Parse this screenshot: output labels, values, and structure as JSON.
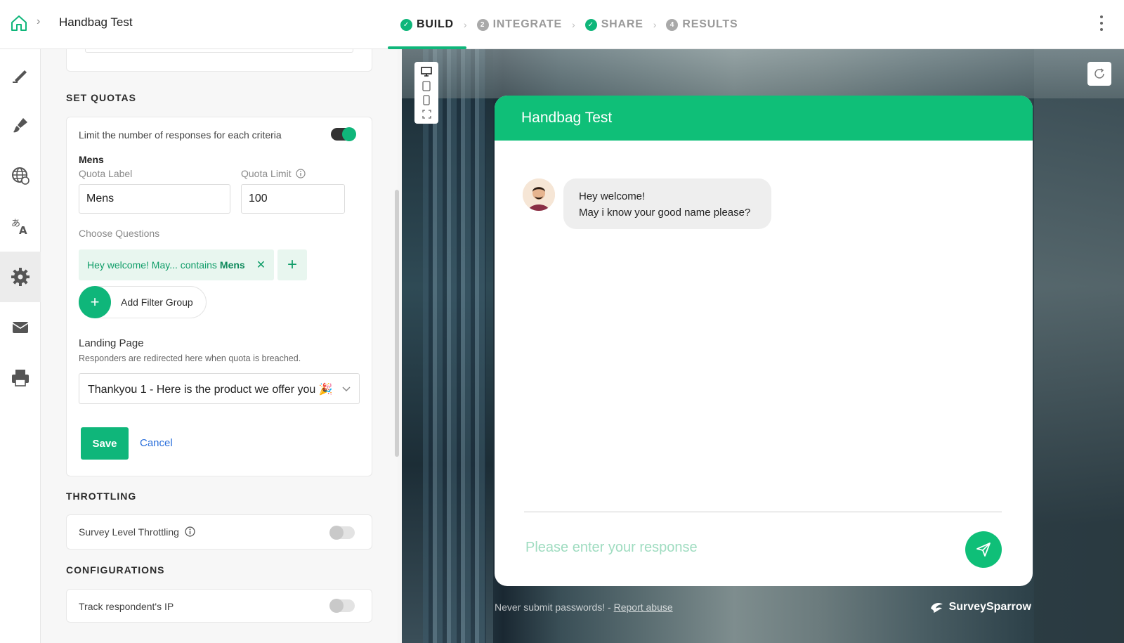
{
  "header": {
    "breadcrumb_title": "Handbag Test",
    "steps": [
      {
        "label": "BUILD",
        "status": "done",
        "badge": "✓"
      },
      {
        "label": "INTEGRATE",
        "status": "pending",
        "badge": "2"
      },
      {
        "label": "SHARE",
        "status": "done",
        "badge": "✓"
      },
      {
        "label": "RESULTS",
        "status": "pending",
        "badge": "4"
      }
    ],
    "active_step": "BUILD"
  },
  "rail": {
    "items": [
      "edit-icon",
      "brush-icon",
      "globe-icon",
      "translate-icon",
      "gear-icon",
      "mail-icon",
      "printer-icon"
    ],
    "active": "gear-icon"
  },
  "quotas": {
    "section_title": "SET QUOTAS",
    "limit_text": "Limit the number of responses for each criteria",
    "limit_enabled": true,
    "group_name": "Mens",
    "quota_label_caption": "Quota Label",
    "quota_label_value": "Mens",
    "quota_limit_caption": "Quota Limit",
    "quota_limit_value": "100",
    "choose_questions": "Choose Questions",
    "filter_prefix": "Hey welcome! May... contains",
    "filter_value": "Mens",
    "add_filter_group": "Add Filter Group",
    "landing_page_title": "Landing Page",
    "landing_page_desc": "Responders are redirected here when quota is breached.",
    "landing_page_value": "Thankyou 1 - Here is the product we offer you 🎉",
    "save": "Save",
    "cancel": "Cancel"
  },
  "throttling": {
    "section_title": "THROTTLING",
    "label": "Survey Level Throttling",
    "enabled": false
  },
  "configurations": {
    "section_title": "CONFIGURATIONS",
    "label": "Track respondent's IP",
    "enabled": false
  },
  "preview": {
    "chat_title": "Handbag Test",
    "bubble_line1": "Hey welcome!",
    "bubble_line2": "May i know your good name please?",
    "input_placeholder": "Please enter your response",
    "footer_text": "Never submit passwords! - ",
    "report_link": "Report abuse",
    "brand": "SurveySparrow",
    "accent": "#0fbf78"
  }
}
